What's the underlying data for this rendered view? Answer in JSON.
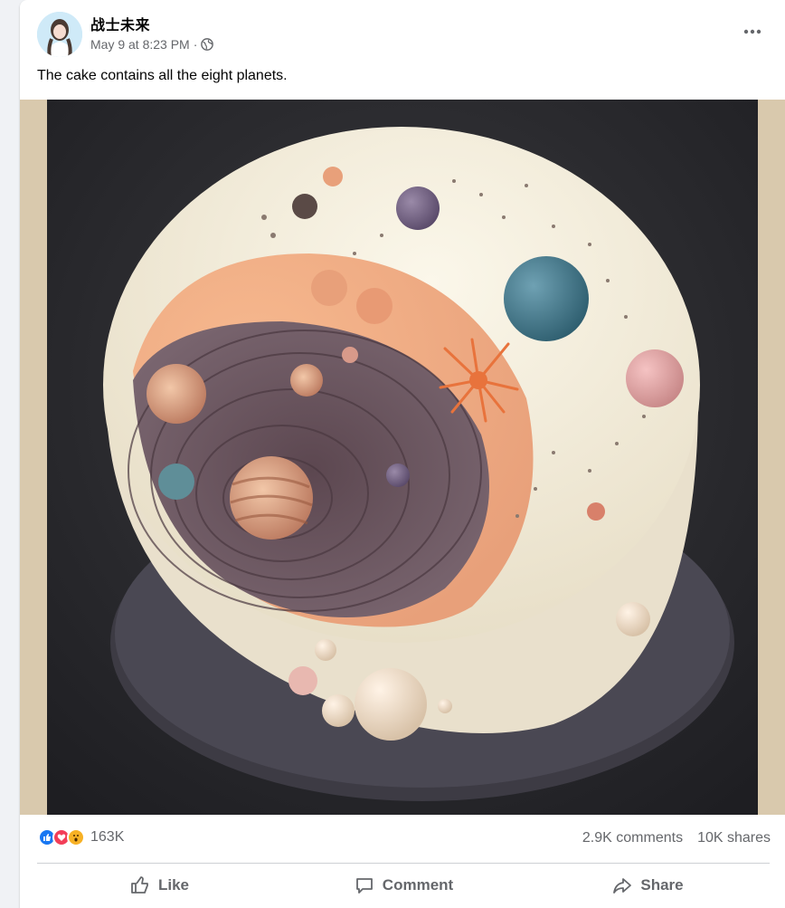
{
  "post": {
    "author": "战士未来",
    "timestamp": "May 9 at 8:23 PM",
    "separator": "·",
    "privacy_icon": "globe-icon",
    "more_icon": "more-options-icon",
    "caption": "The cake contains all the eight planets."
  },
  "stats": {
    "reaction_count": "163K",
    "reactions": [
      "like",
      "love",
      "wow"
    ],
    "comments": "2.9K comments",
    "shares": "10K shares"
  },
  "actions": {
    "like": "Like",
    "comment": "Comment",
    "share": "Share"
  },
  "colors": {
    "like_blue": "#1877f2",
    "love_red": "#f33e58",
    "wow_yellow": "#f7b125",
    "text_secondary": "#65676b"
  }
}
